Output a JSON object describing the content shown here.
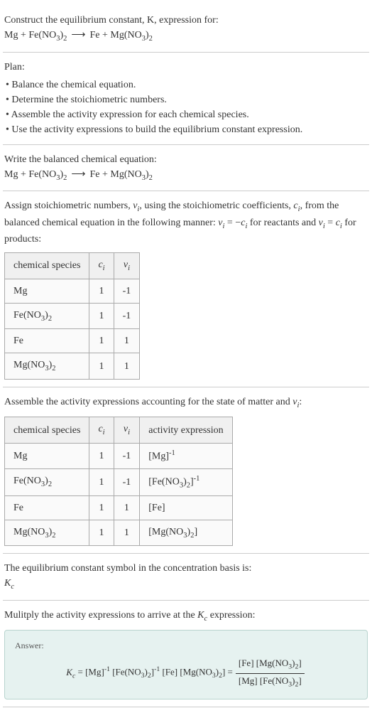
{
  "intro": {
    "line1": "Construct the equilibrium constant, K, expression for:",
    "equation": "Mg + Fe(NO₃)₂ ⟶ Fe + Mg(NO₃)₂"
  },
  "plan": {
    "title": "Plan:",
    "items": [
      "Balance the chemical equation.",
      "Determine the stoichiometric numbers.",
      "Assemble the activity expression for each chemical species.",
      "Use the activity expressions to build the equilibrium constant expression."
    ]
  },
  "balanced": {
    "title": "Write the balanced chemical equation:",
    "equation": "Mg + Fe(NO₃)₂ ⟶ Fe + Mg(NO₃)₂"
  },
  "assign": {
    "text": "Assign stoichiometric numbers, νᵢ, using the stoichiometric coefficients, cᵢ, from the balanced chemical equation in the following manner: νᵢ = −cᵢ for reactants and νᵢ = cᵢ for products:",
    "headers": [
      "chemical species",
      "cᵢ",
      "νᵢ"
    ],
    "rows": [
      {
        "species": "Mg",
        "c": "1",
        "v": "-1"
      },
      {
        "species": "Fe(NO₃)₂",
        "c": "1",
        "v": "-1"
      },
      {
        "species": "Fe",
        "c": "1",
        "v": "1"
      },
      {
        "species": "Mg(NO₃)₂",
        "c": "1",
        "v": "1"
      }
    ]
  },
  "activity": {
    "title": "Assemble the activity expressions accounting for the state of matter and νᵢ:",
    "headers": [
      "chemical species",
      "cᵢ",
      "νᵢ",
      "activity expression"
    ],
    "rows": [
      {
        "species": "Mg",
        "c": "1",
        "v": "-1",
        "expr": "[Mg]⁻¹"
      },
      {
        "species": "Fe(NO₃)₂",
        "c": "1",
        "v": "-1",
        "expr": "[Fe(NO₃)₂]⁻¹"
      },
      {
        "species": "Fe",
        "c": "1",
        "v": "1",
        "expr": "[Fe]"
      },
      {
        "species": "Mg(NO₃)₂",
        "c": "1",
        "v": "1",
        "expr": "[Mg(NO₃)₂]"
      }
    ]
  },
  "symbol": {
    "line1": "The equilibrium constant symbol in the concentration basis is:",
    "line2": "K_c"
  },
  "multiply": {
    "title": "Mulitply the activity expressions to arrive at the K_c expression:"
  },
  "answer": {
    "label": "Answer:",
    "lhs": "K_c = [Mg]⁻¹ [Fe(NO₃)₂]⁻¹ [Fe] [Mg(NO₃)₂] =",
    "num": "[Fe] [Mg(NO₃)₂]",
    "den": "[Mg] [Fe(NO₃)₂]"
  },
  "chart_data": {
    "type": "table",
    "tables": [
      {
        "title": "Stoichiometric numbers",
        "columns": [
          "chemical species",
          "c_i",
          "ν_i"
        ],
        "rows": [
          [
            "Mg",
            1,
            -1
          ],
          [
            "Fe(NO3)2",
            1,
            -1
          ],
          [
            "Fe",
            1,
            1
          ],
          [
            "Mg(NO3)2",
            1,
            1
          ]
        ]
      },
      {
        "title": "Activity expressions",
        "columns": [
          "chemical species",
          "c_i",
          "ν_i",
          "activity expression"
        ],
        "rows": [
          [
            "Mg",
            1,
            -1,
            "[Mg]^-1"
          ],
          [
            "Fe(NO3)2",
            1,
            -1,
            "[Fe(NO3)2]^-1"
          ],
          [
            "Fe",
            1,
            1,
            "[Fe]"
          ],
          [
            "Mg(NO3)2",
            1,
            1,
            "[Mg(NO3)2]"
          ]
        ]
      }
    ]
  }
}
